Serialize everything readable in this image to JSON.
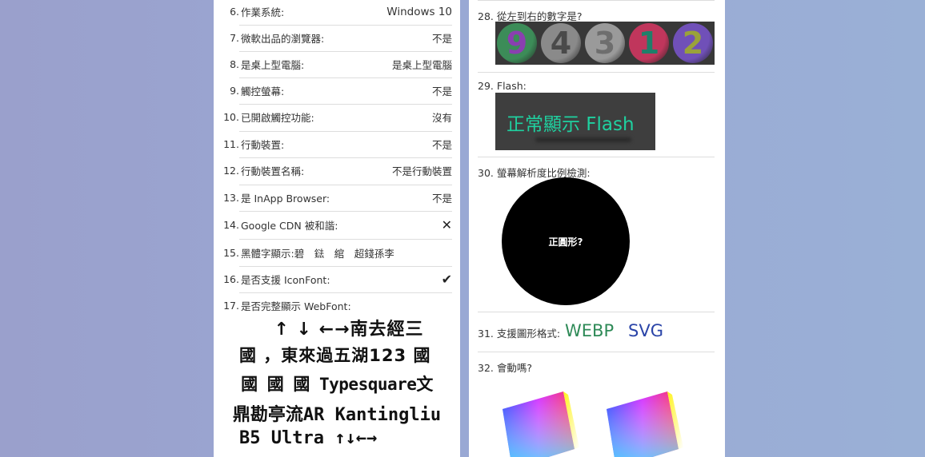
{
  "left_items": [
    {
      "num": "6.",
      "label": "作業系統:",
      "value": "Windows 10"
    },
    {
      "num": "7.",
      "label": "微軟出品的瀏覽器:",
      "value": "不是"
    },
    {
      "num": "8.",
      "label": "是桌上型電腦:",
      "value": "是桌上型電腦"
    },
    {
      "num": "9.",
      "label": "觸控螢幕:",
      "value": "不是"
    },
    {
      "num": "10.",
      "label": "已開啟觸控功能:",
      "value": "沒有"
    },
    {
      "num": "11.",
      "label": "行動裝置:",
      "value": "不是"
    },
    {
      "num": "12.",
      "label": "行動裝置名稱:",
      "value": "不是行動裝置"
    },
    {
      "num": "13.",
      "label": "是 InApp Browser:",
      "value": "不是"
    },
    {
      "num": "14.",
      "label": "Google CDN 被和諧:",
      "icon": "close-icon",
      "value": "✕"
    },
    {
      "num": "15.",
      "label": "黑體字顯示:碧　鍅　綰　超錢孫李",
      "value": ""
    },
    {
      "num": "16.",
      "label": "是否支援 IconFont:",
      "icon": "check-icon",
      "value": "✔"
    },
    {
      "num": "17.",
      "label": "是否完整顯示 WebFont:",
      "value": ""
    }
  ],
  "webfont_lines": [
    "↑ ↓ ←→南去經三",
    "國 ，東來過五湖123 國",
    "國 國 國 Typesquare文",
    "鼎勘亭流AR Kantingliu",
    "B5 Ultra ↑↓←→"
  ],
  "right_items": {
    "q28": {
      "num": "28.",
      "label": "從左到右的數字是?",
      "plates": [
        {
          "digit": "9",
          "bg": "#3c8c58",
          "fg": "#8a3fb0"
        },
        {
          "digit": "4",
          "bg": "#8a8a8a",
          "fg": "#4a4a4a"
        },
        {
          "digit": "3",
          "bg": "#9a9a9a",
          "fg": "#6e6e6e"
        },
        {
          "digit": "1",
          "bg": "#c0365c",
          "fg": "#1f7f6a"
        },
        {
          "digit": "2",
          "bg": "#7050b8",
          "fg": "#9aa23a"
        }
      ]
    },
    "q29": {
      "num": "29.",
      "label": "Flash:",
      "flash_text": "正常顯示 Flash"
    },
    "q30": {
      "num": "30.",
      "label": "螢幕解析度比例檢測:",
      "circle_text": "正圓形?"
    },
    "q31": {
      "num": "31.",
      "label": "支援圖形格式:",
      "formats": [
        {
          "name": "WEBP",
          "color": "#2e8a57"
        },
        {
          "name": "SVG",
          "color": "#2a44a8"
        }
      ]
    },
    "q32": {
      "num": "32.",
      "label": "會動嗎?"
    }
  }
}
